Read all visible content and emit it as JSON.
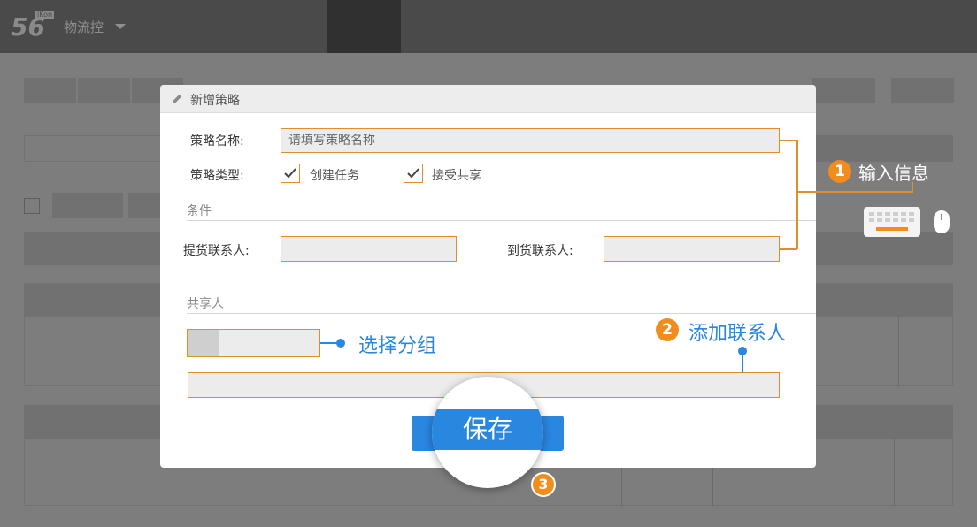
{
  "app": {
    "logo_number": "56",
    "logo_tag": "iKon",
    "name": "物流控"
  },
  "modal": {
    "title": "新增策略",
    "strategy_name": {
      "label": "策略名称:",
      "placeholder": "请填写策略名称"
    },
    "strategy_type": {
      "label": "策略类型:",
      "options": [
        {
          "label": "创建任务",
          "checked": true
        },
        {
          "label": "接受共享",
          "checked": true
        }
      ]
    },
    "conditions": {
      "title": "条件",
      "pickup_contact_label": "提货联系人:",
      "delivery_contact_label": "到货联系人:"
    },
    "sharers": {
      "title": "共享人"
    },
    "save_label": "保存"
  },
  "annotations": {
    "step1": {
      "number": "1",
      "text": "输入信息"
    },
    "step2": {
      "number": "2",
      "text": "添加联系人"
    },
    "step3": {
      "number": "3"
    },
    "select_group": "选择分组"
  },
  "colors": {
    "accent_blue": "#2a87e0",
    "accent_orange": "#e08e2b",
    "badge_orange": "#f28c1c",
    "overlay": "#7d7d7d"
  },
  "icons": [
    "pencil-icon",
    "check-icon",
    "keyboard-icon",
    "mouse-icon",
    "chevron-down-icon"
  ]
}
